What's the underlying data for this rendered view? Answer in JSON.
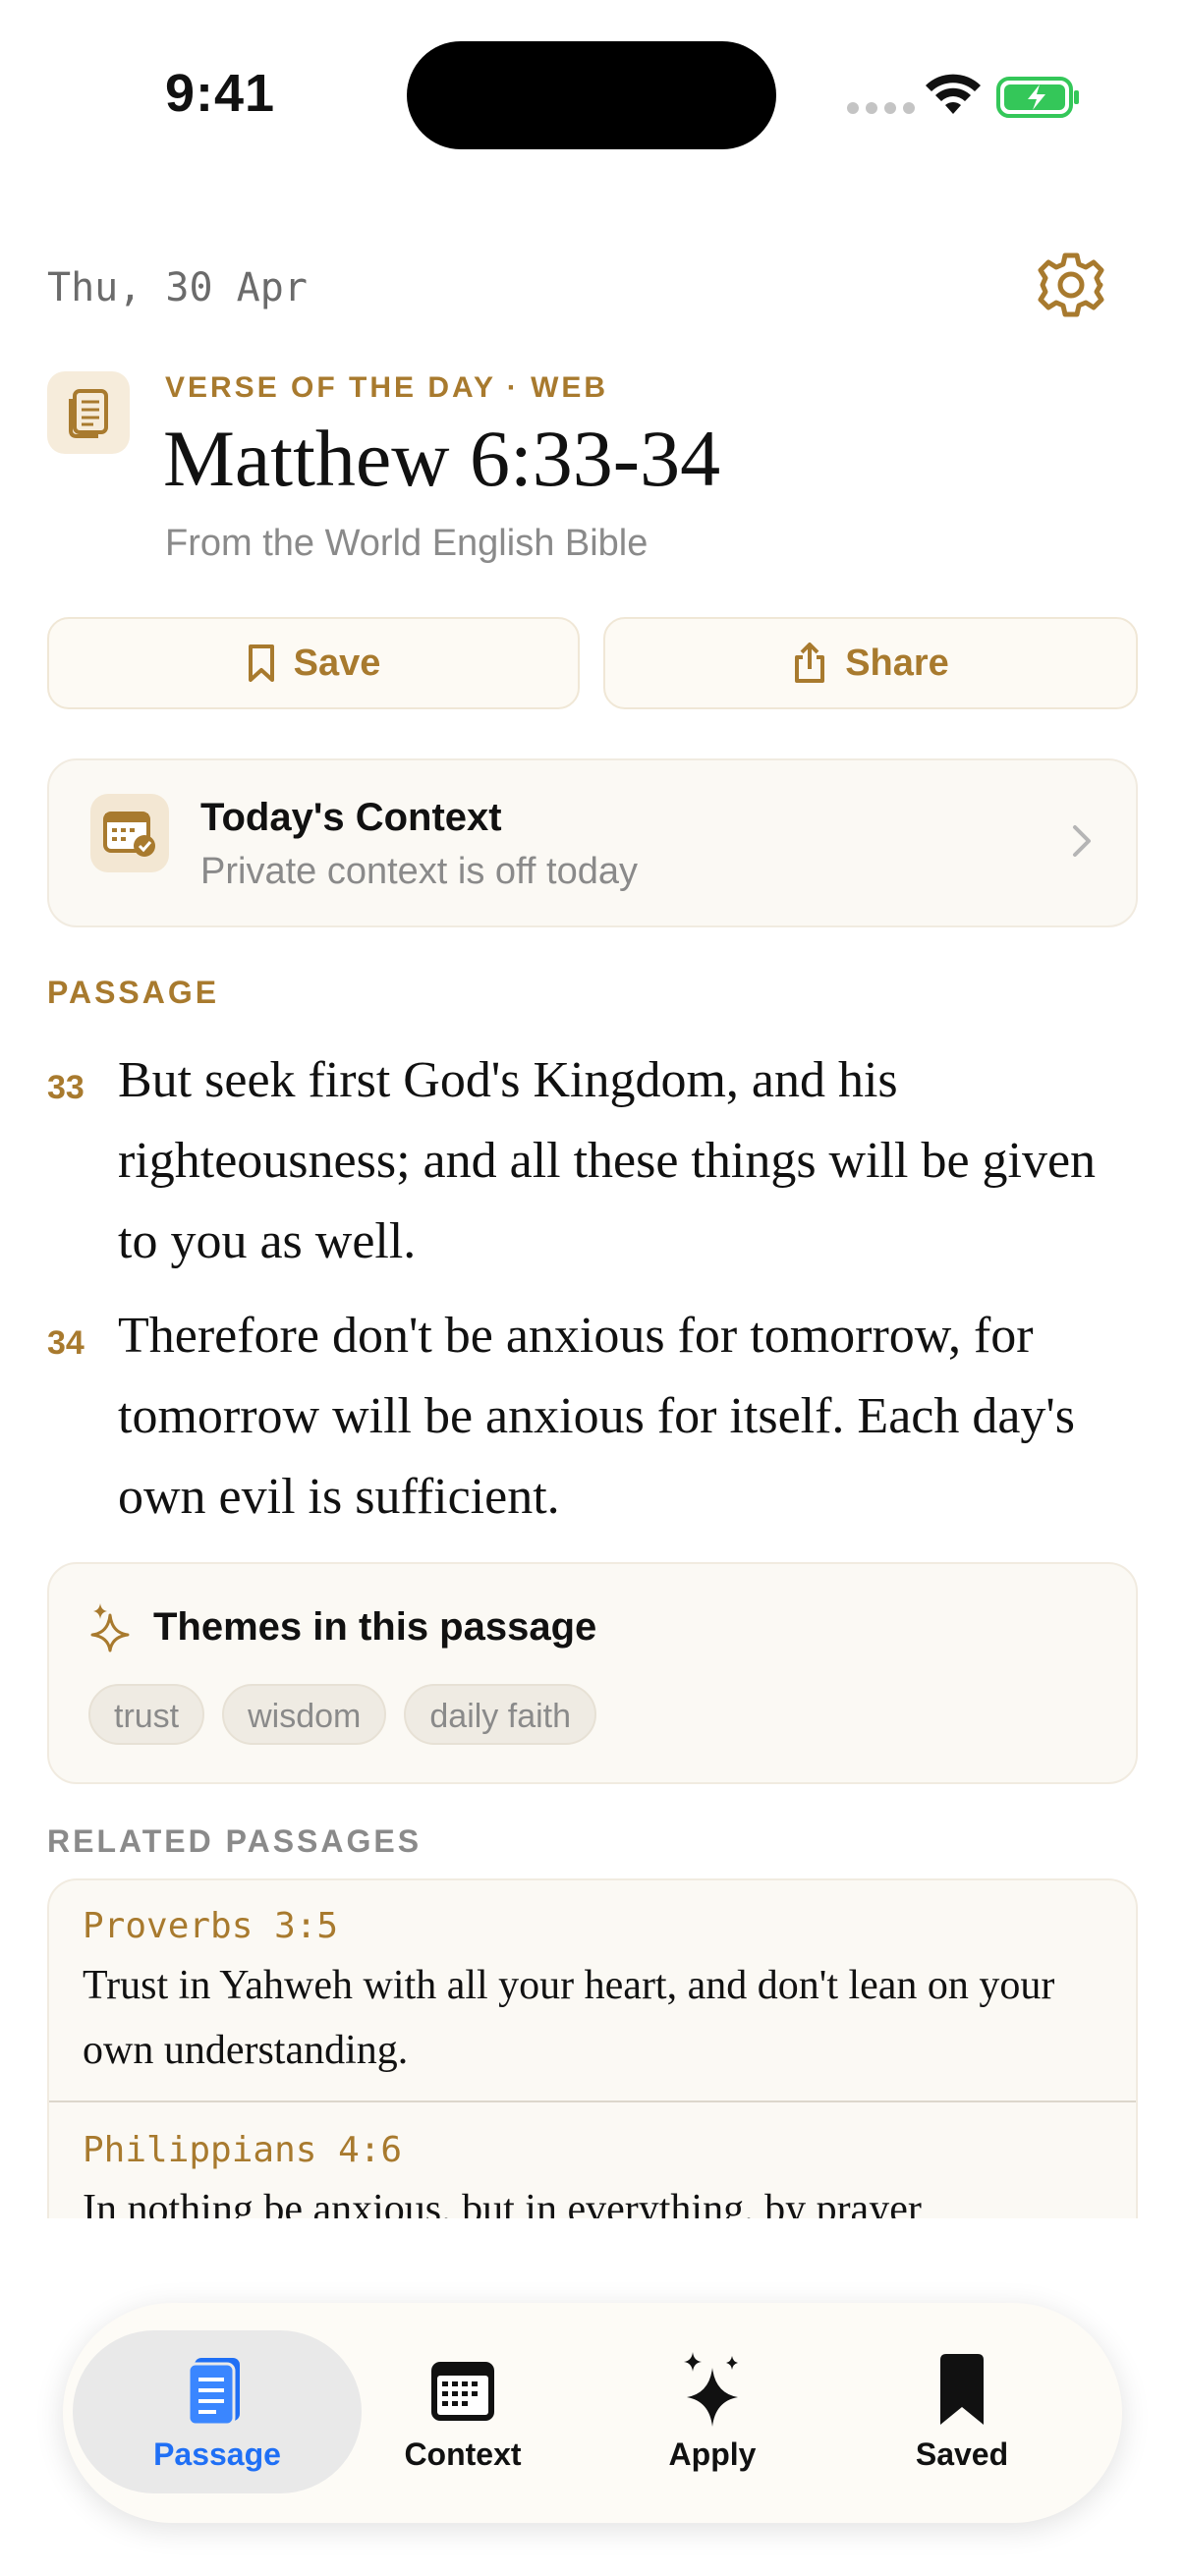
{
  "status_bar": {
    "time": "9:41"
  },
  "header": {
    "date": "Thu, 30 Apr"
  },
  "verse_of_day": {
    "kicker": "VERSE OF THE DAY · WEB",
    "reference": "Matthew 6:33-34",
    "source": "From the World English Bible"
  },
  "actions": {
    "save_label": "Save",
    "share_label": "Share"
  },
  "context_card": {
    "title": "Today's Context",
    "subtitle": "Private context is off today"
  },
  "passage": {
    "label": "PASSAGE",
    "verses": [
      {
        "number": "33",
        "text": "But seek first God's Kingdom, and his righteousness; and all these things will be given to you as well."
      },
      {
        "number": "34",
        "text": "Therefore don't be anxious for tomorrow, for tomorrow will be anxious for itself. Each day's own evil is sufficient."
      }
    ]
  },
  "themes": {
    "title": "Themes in this passage",
    "tags": [
      "trust",
      "wisdom",
      "daily faith"
    ]
  },
  "related": {
    "label": "RELATED PASSAGES",
    "items": [
      {
        "reference": "Proverbs 3:5",
        "text": "Trust in Yahweh with all your heart, and don't lean on your own understanding."
      },
      {
        "reference": "Philippians 4:6",
        "text": "In nothing be anxious, but in everything, by prayer"
      }
    ]
  },
  "tab_bar": {
    "tabs": [
      {
        "label": "Passage",
        "icon": "book-icon",
        "active": true
      },
      {
        "label": "Context",
        "icon": "calendar-icon",
        "active": false
      },
      {
        "label": "Apply",
        "icon": "sparkles-icon",
        "active": false
      },
      {
        "label": "Saved",
        "icon": "bookmark-icon",
        "active": false
      }
    ]
  },
  "colors": {
    "accent": "#a87a2e",
    "active_tab": "#1f6ff5",
    "card_bg": "#fbf9f4"
  }
}
